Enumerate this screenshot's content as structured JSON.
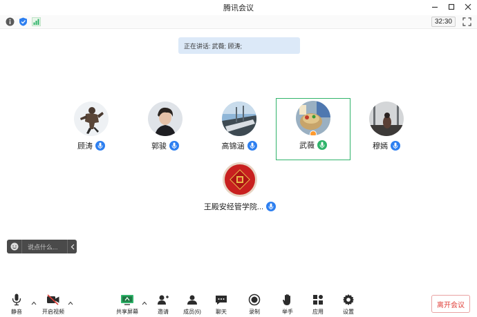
{
  "window": {
    "title": "腾讯会议"
  },
  "status": {
    "timer": "32:30"
  },
  "speaking": {
    "label": "正在讲话:",
    "names": "武薇; 顾涛;"
  },
  "participants": [
    {
      "name": "顾涛"
    },
    {
      "name": "郭骏"
    },
    {
      "name": "高锦涵"
    },
    {
      "name": "武薇"
    },
    {
      "name": "穆嫣"
    },
    {
      "name": "王殿安经管学院..."
    }
  ],
  "chat": {
    "placeholder": "说点什么..."
  },
  "toolbar": {
    "mute": "静音",
    "video": "开启视频",
    "share": "共享屏幕",
    "invite": "邀请",
    "members": "成员(6)",
    "chat": "聊天",
    "record": "录制",
    "raise_hand": "举手",
    "apps": "应用",
    "settings": "设置",
    "leave": "离开会议"
  },
  "colors": {
    "accent": "#2d7ff0",
    "active_border": "#2fb36a",
    "leave": "#e0403a"
  }
}
